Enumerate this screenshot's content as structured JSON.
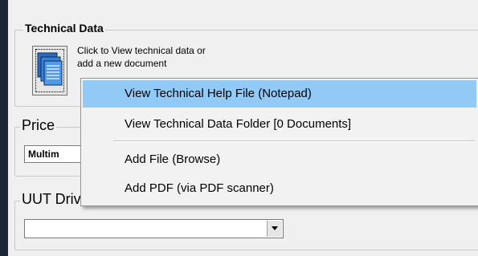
{
  "technical_data": {
    "title": "Technical Data",
    "hint_line1": "Click to View technical data or",
    "hint_line2": "add a new document"
  },
  "price": {
    "title": "Price",
    "value": "Multim"
  },
  "uut_driver": {
    "title": "UUT Driver",
    "value": ""
  },
  "context_menu": {
    "items": [
      "View Technical Help File (Notepad)",
      "View Technical Data Folder [0 Documents]",
      "Add File (Browse)",
      "Add PDF (via PDF scanner)"
    ],
    "highlighted_index": 0,
    "highlight_color": "#91c9f7"
  }
}
